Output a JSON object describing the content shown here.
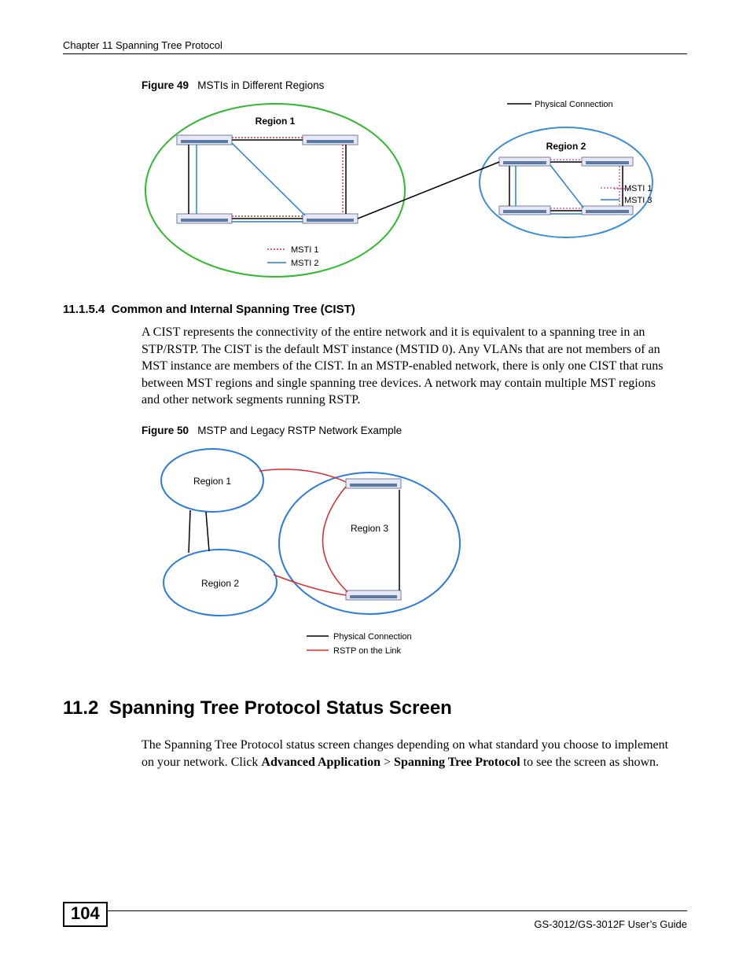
{
  "header": {
    "chapter": "Chapter 11 Spanning Tree Protocol"
  },
  "figure49": {
    "label": "Figure 49",
    "title": "MSTIs in Different Regions",
    "legend": {
      "physical": "Physical Connection"
    },
    "region1": {
      "label": "Region 1",
      "legend": {
        "msti1": "MSTI 1",
        "msti2": "MSTI 2"
      }
    },
    "region2": {
      "label": "Region 2",
      "legend": {
        "msti1": "MSTI 1",
        "msti3": "MSTI 3"
      }
    }
  },
  "section_11_1_5_4": {
    "number": "11.1.5.4",
    "title": "Common and Internal Spanning Tree (CIST)",
    "body": "A CIST represents the connectivity of the entire network and it is equivalent to a spanning tree in an STP/RSTP. The CIST is the default MST instance (MSTID 0). Any VLANs that are not members of an MST instance are members of the CIST. In an MSTP-enabled network, there is only one CIST that runs between MST regions and single spanning tree devices. A network may contain multiple MST regions and other network segments running RSTP."
  },
  "figure50": {
    "label": "Figure 50",
    "title": "MSTP and Legacy RSTP Network Example",
    "region1": "Region 1",
    "region2": "Region 2",
    "region3": "Region 3",
    "legend": {
      "physical": "Physical Connection",
      "rstp": "RSTP on the Link"
    }
  },
  "section_11_2": {
    "number": "11.2",
    "title": "Spanning Tree Protocol Status Screen",
    "body_pre": "The Spanning Tree Protocol status screen changes depending on what standard you choose to implement on your network. Click ",
    "bold1": "Advanced Application",
    "gt": " > ",
    "bold2": "Spanning Tree Protocol",
    "body_post": " to see the screen as shown."
  },
  "footer": {
    "page": "104",
    "guide": "GS-3012/GS-3012F User’s Guide"
  }
}
